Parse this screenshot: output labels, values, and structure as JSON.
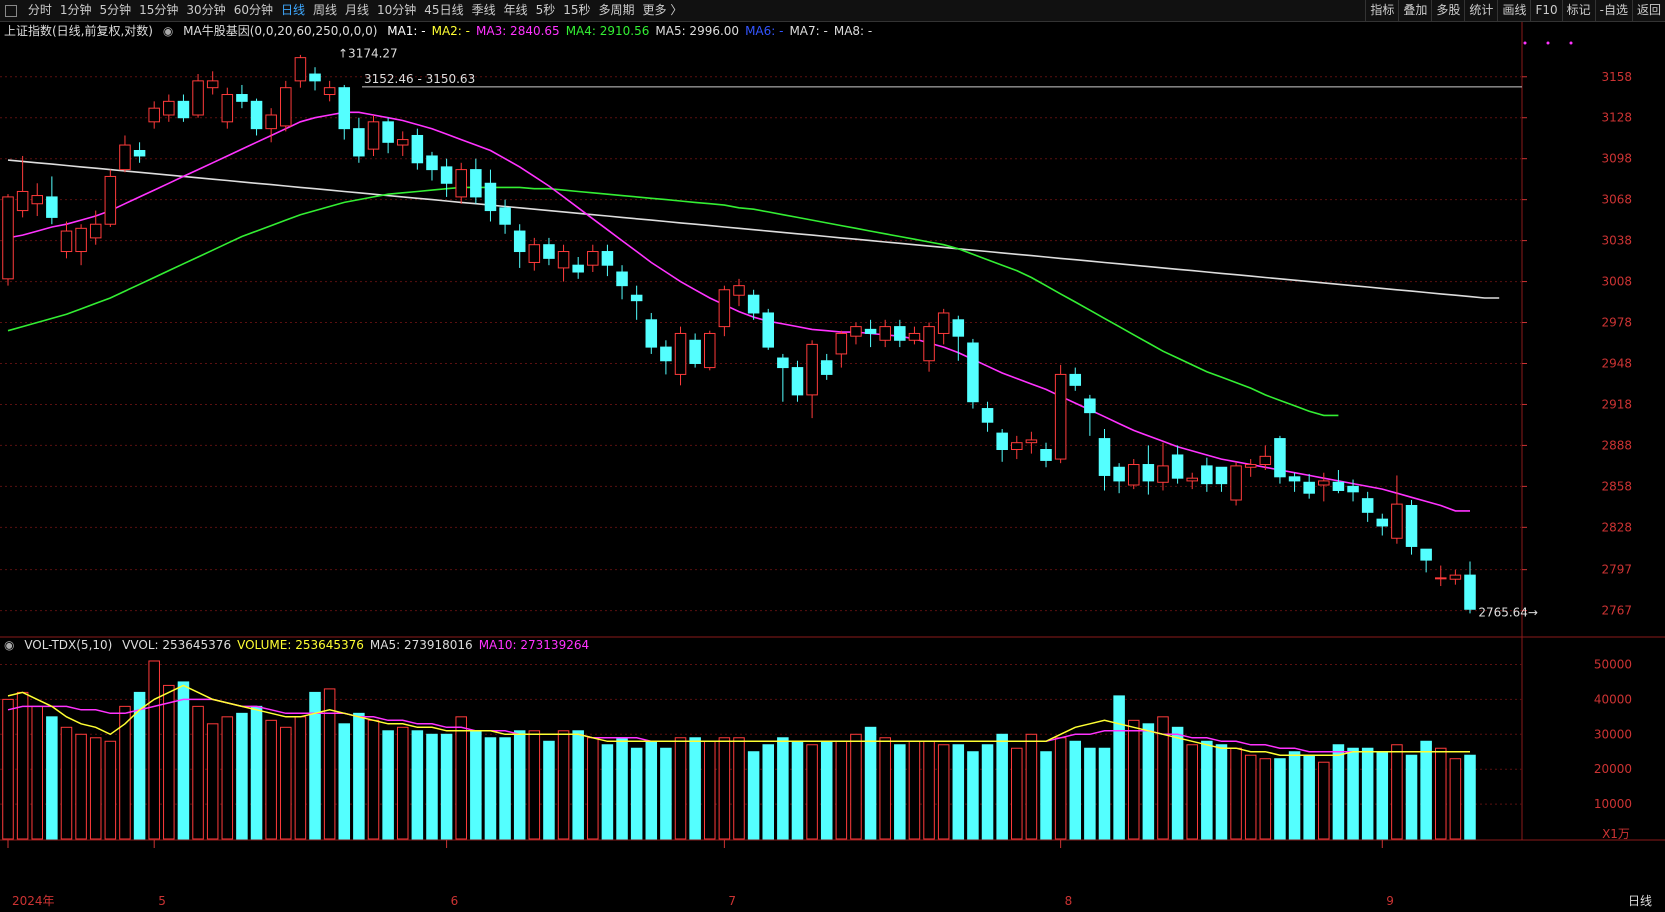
{
  "toolbar": {
    "tabs": [
      "分时",
      "1分钟",
      "5分钟",
      "15分钟",
      "30分钟",
      "60分钟",
      "日线",
      "周线",
      "月线",
      "10分钟",
      "45日线",
      "季线",
      "年线",
      "5秒",
      "15秒",
      "多周期",
      "更多 〉"
    ],
    "active": "日线",
    "right": [
      "指标",
      "叠加",
      "多股",
      "统计",
      "画线",
      "F10",
      "标记",
      "-自选",
      "返回"
    ]
  },
  "price_legend": {
    "title": "上证指数(日线,前复权,对数)",
    "indicator": "MA牛股基因(0,0,20,60,250,0,0,0)",
    "items": [
      {
        "label": "MA1: -",
        "color": "#ffffff"
      },
      {
        "label": "MA2: -",
        "color": "#ffff33"
      },
      {
        "label": "MA3: 2840.65",
        "color": "#ff33ff"
      },
      {
        "label": "MA4: 2910.56",
        "color": "#33ee33"
      },
      {
        "label": "MA5: 2996.00",
        "color": "#dddddd"
      },
      {
        "label": "MA6: -",
        "color": "#3355ff"
      },
      {
        "label": "MA7: -",
        "color": "#dddddd"
      },
      {
        "label": "MA8: -",
        "color": "#dddddd"
      }
    ]
  },
  "vol_legend": {
    "title": "VOL-TDX(5,10)",
    "items": [
      {
        "label": "VVOL: 253645376",
        "color": "#dddddd"
      },
      {
        "label": "VOLUME: 253645376",
        "color": "#ffff33"
      },
      {
        "label": "MA5: 273918016",
        "color": "#dddddd"
      },
      {
        "label": "MA10: 273139264",
        "color": "#ff33ff"
      }
    ]
  },
  "annotations": {
    "high": "3174.27",
    "level": "3152.46 - 3150.63",
    "low": "2765.64"
  },
  "chart_data": {
    "type": "candlestick",
    "y_ticks": [
      3158,
      3128,
      3098,
      3068,
      3038,
      3008,
      2978,
      2948,
      2918,
      2888,
      2858,
      2828,
      2797,
      2767
    ],
    "vol_ticks": [
      "50000",
      "40000",
      "30000",
      "20000",
      "10000"
    ],
    "vol_unit": "X1万",
    "period_label": "日线",
    "x_labels": [
      {
        "label": "2024年",
        "i": 0
      },
      {
        "label": "5",
        "i": 10
      },
      {
        "label": "6",
        "i": 30
      },
      {
        "label": "7",
        "i": 49
      },
      {
        "label": "8",
        "i": 72
      },
      {
        "label": "9",
        "i": 94
      }
    ],
    "ohlc": [
      [
        3010,
        3070,
        3005,
        3072
      ],
      [
        3060,
        3074,
        3055,
        3100
      ],
      [
        3065,
        3071,
        3056,
        3080
      ],
      [
        3070,
        3055,
        3050,
        3085
      ],
      [
        3030,
        3045,
        3025,
        3052
      ],
      [
        3030,
        3047,
        3020,
        3050
      ],
      [
        3040,
        3050,
        3035,
        3060
      ],
      [
        3050,
        3085,
        3048,
        3090
      ],
      [
        3090,
        3108,
        3088,
        3115
      ],
      [
        3104,
        3100,
        3095,
        3110
      ],
      [
        3125,
        3135,
        3120,
        3140
      ],
      [
        3130,
        3140,
        3125,
        3145
      ],
      [
        3140,
        3128,
        3125,
        3145
      ],
      [
        3130,
        3155,
        3128,
        3160
      ],
      [
        3150,
        3155,
        3145,
        3162
      ],
      [
        3125,
        3145,
        3120,
        3150
      ],
      [
        3145,
        3140,
        3135,
        3152
      ],
      [
        3140,
        3120,
        3115,
        3142
      ],
      [
        3120,
        3130,
        3110,
        3135
      ],
      [
        3122,
        3150,
        3118,
        3155
      ],
      [
        3155,
        3172,
        3150,
        3174
      ],
      [
        3160,
        3155,
        3148,
        3165
      ],
      [
        3145,
        3150,
        3140,
        3155
      ],
      [
        3150,
        3120,
        3112,
        3152
      ],
      [
        3120,
        3100,
        3095,
        3128
      ],
      [
        3105,
        3125,
        3100,
        3130
      ],
      [
        3125,
        3110,
        3102,
        3128
      ],
      [
        3108,
        3112,
        3100,
        3118
      ],
      [
        3115,
        3095,
        3090,
        3120
      ],
      [
        3100,
        3090,
        3082,
        3103
      ],
      [
        3092,
        3080,
        3070,
        3098
      ],
      [
        3070,
        3090,
        3065,
        3095
      ],
      [
        3090,
        3070,
        3065,
        3098
      ],
      [
        3080,
        3060,
        3052,
        3090
      ],
      [
        3062,
        3050,
        3043,
        3068
      ],
      [
        3045,
        3030,
        3018,
        3050
      ],
      [
        3022,
        3035,
        3016,
        3040
      ],
      [
        3035,
        3025,
        3020,
        3040
      ],
      [
        3018,
        3030,
        3008,
        3035
      ],
      [
        3020,
        3015,
        3010,
        3026
      ],
      [
        3020,
        3030,
        3015,
        3035
      ],
      [
        3030,
        3020,
        3012,
        3035
      ],
      [
        3015,
        3005,
        2995,
        3020
      ],
      [
        2998,
        2994,
        2980,
        3005
      ],
      [
        2980,
        2960,
        2955,
        2985
      ],
      [
        2960,
        2950,
        2940,
        2965
      ],
      [
        2940,
        2970,
        2932,
        2975
      ],
      [
        2965,
        2948,
        2945,
        2970
      ],
      [
        2945,
        2970,
        2943,
        2972
      ],
      [
        2975,
        3002,
        2968,
        3005
      ],
      [
        2998,
        3005,
        2990,
        3010
      ],
      [
        2998,
        2985,
        2980,
        3002
      ],
      [
        2985,
        2960,
        2958,
        2988
      ],
      [
        2952,
        2945,
        2920,
        2955
      ],
      [
        2945,
        2925,
        2920,
        2950
      ],
      [
        2925,
        2962,
        2908,
        2965
      ],
      [
        2950,
        2940,
        2936,
        2955
      ],
      [
        2955,
        2970,
        2945,
        2972
      ],
      [
        2968,
        2975,
        2962,
        2978
      ],
      [
        2973,
        2970,
        2960,
        2980
      ],
      [
        2965,
        2975,
        2960,
        2980
      ],
      [
        2975,
        2965,
        2960,
        2980
      ],
      [
        2965,
        2970,
        2962,
        2975
      ],
      [
        2950,
        2975,
        2942,
        2978
      ],
      [
        2970,
        2985,
        2962,
        2988
      ],
      [
        2980,
        2968,
        2950,
        2983
      ],
      [
        2963,
        2920,
        2915,
        2966
      ],
      [
        2915,
        2905,
        2898,
        2920
      ],
      [
        2897,
        2885,
        2876,
        2900
      ],
      [
        2885,
        2890,
        2878,
        2895
      ],
      [
        2890,
        2892,
        2882,
        2898
      ],
      [
        2885,
        2877,
        2872,
        2890
      ],
      [
        2878,
        2940,
        2875,
        2947
      ],
      [
        2940,
        2932,
        2928,
        2945
      ],
      [
        2922,
        2912,
        2895,
        2925
      ],
      [
        2893,
        2866,
        2855,
        2900
      ],
      [
        2872,
        2862,
        2853,
        2875
      ],
      [
        2859,
        2874,
        2856,
        2878
      ],
      [
        2874,
        2862,
        2852,
        2888
      ],
      [
        2861,
        2873,
        2855,
        2890
      ],
      [
        2881,
        2864,
        2860,
        2888
      ],
      [
        2862,
        2864,
        2856,
        2868
      ],
      [
        2873,
        2860,
        2854,
        2879
      ],
      [
        2872,
        2860,
        2854,
        2872
      ],
      [
        2848,
        2873,
        2844,
        2876
      ],
      [
        2872,
        2874,
        2865,
        2878
      ],
      [
        2874,
        2880,
        2870,
        2888
      ],
      [
        2893,
        2865,
        2860,
        2895
      ],
      [
        2865,
        2862,
        2854,
        2868
      ],
      [
        2861,
        2853,
        2849,
        2867
      ],
      [
        2859,
        2862,
        2847,
        2868
      ],
      [
        2861,
        2855,
        2853,
        2870
      ],
      [
        2858,
        2854,
        2847,
        2863
      ],
      [
        2849,
        2839,
        2832,
        2854
      ],
      [
        2834,
        2829,
        2822,
        2838
      ],
      [
        2820,
        2845,
        2816,
        2866
      ],
      [
        2844,
        2814,
        2808,
        2848
      ],
      [
        2812,
        2804,
        2795,
        2812
      ],
      [
        2791,
        2791,
        2785,
        2800
      ],
      [
        2790,
        2793,
        2786,
        2797
      ],
      [
        2793,
        2768,
        2765,
        2803
      ]
    ],
    "volume": [
      40,
      42,
      38,
      35,
      32,
      30,
      29,
      28,
      38,
      42,
      51,
      44,
      45,
      38,
      33,
      35,
      36,
      38,
      34,
      32,
      35,
      42,
      43,
      33,
      36,
      34,
      31,
      32,
      31,
      30,
      30,
      35,
      31,
      29,
      29,
      31,
      31,
      28,
      31,
      31,
      29,
      27,
      29,
      26,
      28,
      26,
      29,
      29,
      28,
      29,
      29,
      25,
      27,
      29,
      28,
      27,
      28,
      28,
      30,
      32,
      29,
      27,
      28,
      28,
      27,
      27,
      25,
      27,
      30,
      26,
      30,
      25,
      29,
      28,
      26,
      26,
      41,
      34,
      33,
      35,
      32,
      27,
      28,
      27,
      26,
      24,
      23,
      23,
      25,
      24,
      22,
      27,
      26,
      26,
      25,
      27,
      24,
      28,
      26,
      23,
      24,
      23,
      23,
      24,
      22,
      27,
      39,
      34,
      30,
      27,
      26,
      24,
      25
    ],
    "vol_ma5": [
      41,
      42,
      40,
      38,
      35,
      33,
      32,
      30,
      33,
      37,
      40,
      42,
      44,
      42,
      40,
      39,
      38,
      37,
      36,
      35,
      35,
      36,
      37,
      36,
      35,
      34,
      33,
      33,
      32,
      32,
      31,
      31,
      31,
      31,
      30,
      30,
      30,
      30,
      30,
      30,
      29,
      28,
      28,
      28,
      28,
      28,
      28,
      28,
      28,
      28,
      28,
      28,
      28,
      28,
      28,
      28,
      28,
      28,
      28,
      28,
      28,
      28,
      28,
      28,
      28,
      28,
      28,
      28,
      28,
      28,
      28,
      28,
      30,
      32,
      33,
      34,
      33,
      32,
      31,
      30,
      29,
      28,
      27,
      26,
      26,
      25,
      25,
      24,
      24,
      24,
      24,
      24,
      25,
      25,
      25,
      25,
      25,
      25,
      25,
      25,
      25,
      25,
      25,
      25,
      25,
      26,
      29,
      30,
      30,
      29,
      28,
      28,
      27
    ],
    "vol_ma10": [
      37,
      38,
      38,
      38,
      38,
      37,
      37,
      36,
      36,
      37,
      38,
      39,
      40,
      40,
      40,
      39,
      38,
      38,
      37,
      36,
      36,
      36,
      36,
      36,
      35,
      35,
      34,
      34,
      33,
      33,
      32,
      32,
      31,
      31,
      31,
      30,
      30,
      30,
      30,
      30,
      29,
      29,
      29,
      29,
      28,
      28,
      28,
      28,
      28,
      28,
      28,
      28,
      28,
      28,
      28,
      28,
      28,
      28,
      28,
      28,
      28,
      28,
      28,
      28,
      28,
      28,
      28,
      28,
      28,
      28,
      28,
      28,
      29,
      30,
      30,
      31,
      31,
      31,
      31,
      30,
      30,
      29,
      29,
      28,
      28,
      27,
      27,
      26,
      26,
      25,
      25,
      25,
      25,
      25,
      25,
      25,
      25,
      25,
      25,
      25,
      25,
      25,
      25,
      25,
      25,
      25,
      26,
      27,
      27,
      27,
      27,
      27,
      27
    ],
    "ma3": [
      3040,
      3042,
      3045,
      3048,
      3050,
      3053,
      3056,
      3060,
      3065,
      3070,
      3075,
      3080,
      3085,
      3090,
      3095,
      3100,
      3105,
      3110,
      3115,
      3120,
      3125,
      3128,
      3130,
      3132,
      3132,
      3130,
      3128,
      3126,
      3123,
      3120,
      3116,
      3112,
      3108,
      3104,
      3098,
      3092,
      3085,
      3078,
      3070,
      3062,
      3054,
      3046,
      3038,
      3030,
      3022,
      3015,
      3008,
      3002,
      2996,
      2991,
      2986,
      2982,
      2979,
      2977,
      2975,
      2973,
      2972,
      2971,
      2971,
      2970,
      2969,
      2968,
      2966,
      2963,
      2960,
      2956,
      2951,
      2946,
      2941,
      2937,
      2933,
      2929,
      2924,
      2919,
      2914,
      2909,
      2904,
      2899,
      2895,
      2891,
      2887,
      2884,
      2881,
      2878,
      2876,
      2874,
      2872,
      2870,
      2868,
      2866,
      2864,
      2862,
      2860,
      2858,
      2856,
      2853,
      2850,
      2847,
      2844,
      2840,
      2840
    ],
    "ma4": [
      2972,
      2975,
      2978,
      2981,
      2984,
      2988,
      2992,
      2996,
      3001,
      3006,
      3011,
      3016,
      3021,
      3026,
      3031,
      3036,
      3041,
      3045,
      3049,
      3053,
      3057,
      3060,
      3063,
      3066,
      3068,
      3070,
      3072,
      3073,
      3074,
      3075,
      3076,
      3077,
      3077,
      3077,
      3077,
      3077,
      3076,
      3076,
      3075,
      3074,
      3073,
      3072,
      3071,
      3070,
      3069,
      3068,
      3067,
      3066,
      3065,
      3064,
      3062,
      3061,
      3059,
      3057,
      3055,
      3053,
      3051,
      3049,
      3047,
      3045,
      3043,
      3041,
      3039,
      3037,
      3035,
      3032,
      3028,
      3024,
      3020,
      3016,
      3011,
      3005,
      2999,
      2993,
      2987,
      2981,
      2975,
      2969,
      2963,
      2957,
      2952,
      2947,
      2942,
      2938,
      2934,
      2930,
      2925,
      2921,
      2917,
      2913,
      2910,
      2910
    ],
    "ma5": [
      3097,
      3096,
      3095,
      3094,
      3093,
      3092,
      3091,
      3090,
      3089,
      3088,
      3087,
      3086,
      3085,
      3084,
      3083,
      3082,
      3081,
      3080,
      3079,
      3078,
      3077,
      3076,
      3075,
      3074,
      3073,
      3072,
      3071,
      3070,
      3069,
      3068,
      3067,
      3066,
      3065,
      3064,
      3063,
      3062,
      3061,
      3060,
      3059,
      3058,
      3057,
      3056,
      3055,
      3054,
      3053,
      3052,
      3051,
      3050,
      3049,
      3048,
      3047,
      3046,
      3045,
      3044,
      3043,
      3042,
      3041,
      3040,
      3039,
      3038,
      3037,
      3036,
      3035,
      3034,
      3033,
      3032,
      3031,
      3030,
      3029,
      3028,
      3027,
      3026,
      3025,
      3024,
      3023,
      3022,
      3021,
      3020,
      3019,
      3018,
      3017,
      3016,
      3015,
      3014,
      3013,
      3012,
      3011,
      3010,
      3009,
      3008,
      3007,
      3006,
      3005,
      3004,
      3003,
      3002,
      3001,
      3000,
      2999,
      2998,
      2997,
      2996,
      2996
    ]
  }
}
